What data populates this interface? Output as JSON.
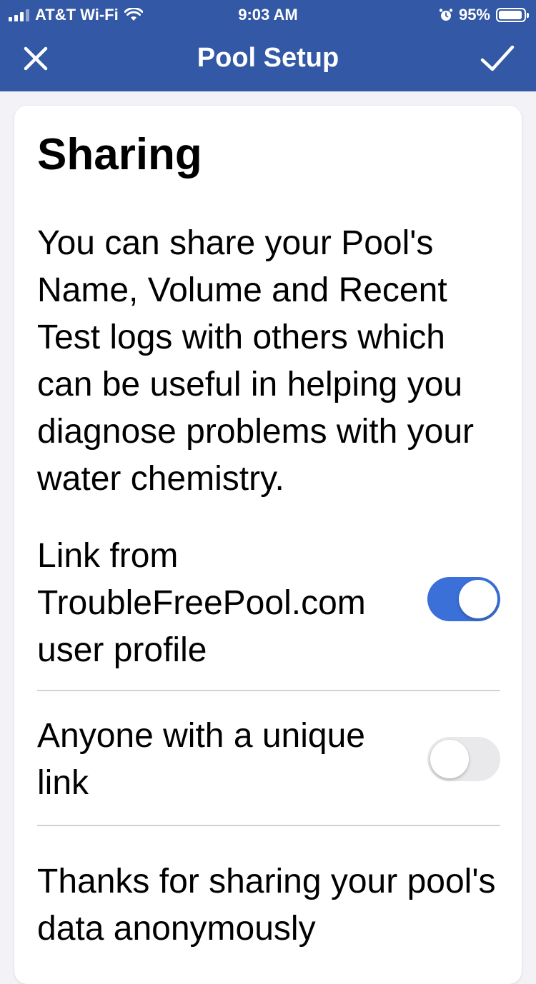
{
  "colors": {
    "brand": "#3358a5",
    "accent": "#3a70d8",
    "divider": "#d1d1d6"
  },
  "status_bar": {
    "carrier": "AT&T Wi-Fi",
    "time": "9:03 AM",
    "battery_percent": "95%",
    "battery_level": 0.95,
    "icons": [
      "signal-icon",
      "wifi-icon",
      "alarm-icon",
      "battery-icon"
    ]
  },
  "nav": {
    "title": "Pool Setup",
    "left_icon": "close-icon",
    "right_icon": "checkmark-icon"
  },
  "sharing": {
    "heading": "Sharing",
    "description": "You can share your Pool's Name, Volume and Recent Test logs with others which can be useful in helping you diagnose problems with your water chemistry.",
    "options": [
      {
        "label": "Link from TroubleFreePool.com user profile",
        "enabled": true
      },
      {
        "label": "Anyone with a unique link",
        "enabled": false
      }
    ],
    "footer": "Thanks for sharing your pool's data anonymously"
  }
}
